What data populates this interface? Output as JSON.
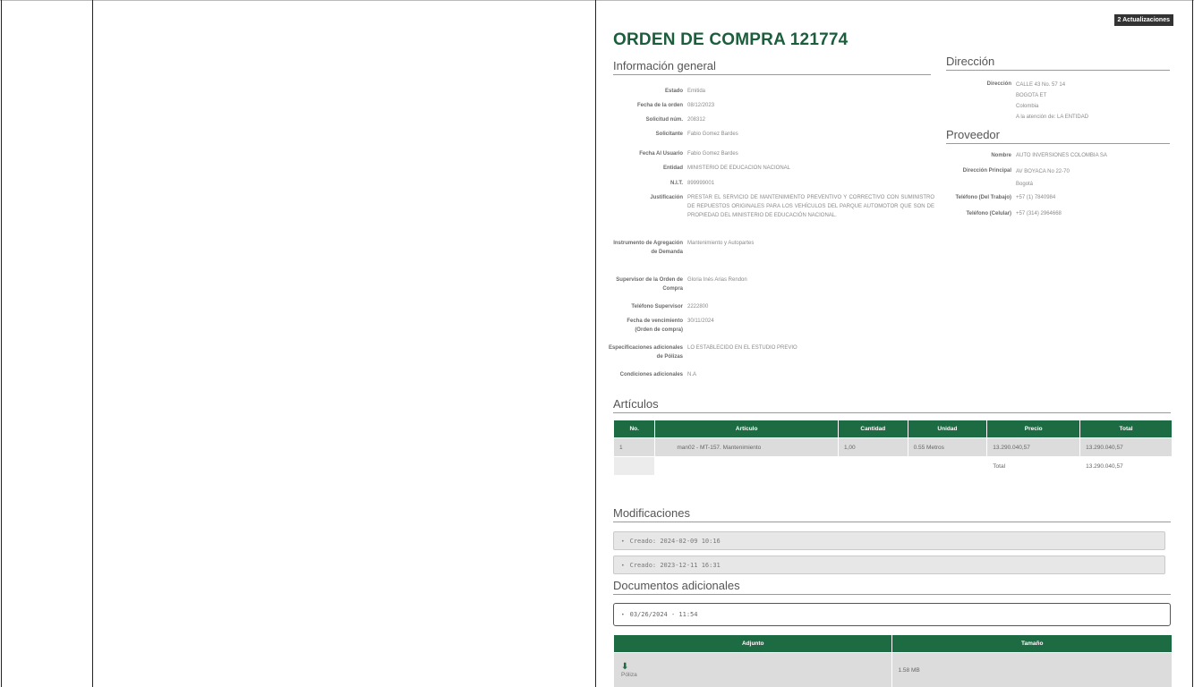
{
  "badge": "2 Actualizaciones",
  "title": "ORDEN DE COMPRA 121774",
  "info": {
    "heading": "Información general",
    "rows": [
      {
        "k": "Estado",
        "v": "Emitida"
      },
      {
        "k": "Fecha de la orden",
        "v": "08/12/2023"
      },
      {
        "k": "Solicitud núm.",
        "v": "208312"
      },
      {
        "k": "Solicitante",
        "v": "Fabio Gomez Bardes"
      },
      {
        "k": "Fecha Al Usuario",
        "v": "Fabio Gomez Bardes"
      },
      {
        "k": "Entidad",
        "v": "MINISTERIO DE EDUCACION NACIONAL"
      },
      {
        "k": "N.I.T.",
        "v": "899999001"
      },
      {
        "k": "Justificación",
        "v": "PRESTAR EL SERVICIO DE MANTENIMIENTO PREVENTIVO Y CORRECTIVO CON SUMINISTRO DE REPUESTOS ORIGINALES PARA LOS VEHÍCULOS DEL PARQUE AUTOMOTOR QUE SON DE PROPIEDAD DEL MINISTERIO DE EDUCACIÓN NACIONAL."
      },
      {
        "k": "Instrumento de Agregación de Demanda",
        "v": "Mantenimiento y Autopartes"
      },
      {
        "k": "Supervisor de la Orden de Compra",
        "v": "Gloria Inés Arias Rendon"
      },
      {
        "k": "Teléfono Supervisor",
        "v": "2222800"
      },
      {
        "k": "Fecha de vencimiento (Orden de compra)",
        "v": "30/11/2024"
      },
      {
        "k": "Especificaciones adicionales de Pólizas",
        "v": "LO ESTABLECIDO EN EL ESTUDIO PREVIO"
      },
      {
        "k": "Condiciones adicionales",
        "v": "N.A"
      }
    ]
  },
  "direccion": {
    "heading": "Dirección",
    "label": "Dirección",
    "lines": [
      "CALLE 43 No. 57 14",
      "BOGOTA ET",
      "Colombia",
      "A la atención de: LA ENTIDAD"
    ]
  },
  "proveedor": {
    "heading": "Proveedor",
    "rows": [
      {
        "k": "Nombre",
        "v": "AUTO INVERSIONES COLOMBIA SA"
      },
      {
        "k": "Dirección Principal",
        "v": "AV BOYACA No 22-70"
      },
      {
        "k": "",
        "v": "Bogotá"
      },
      {
        "k": "Teléfono (Del Trabajo)",
        "v": "+57 (1) 7840984"
      },
      {
        "k": "Teléfono (Celular)",
        "v": "+57 (314) 2964668"
      }
    ]
  },
  "articulos": {
    "heading": "Artículos",
    "headers": [
      "No.",
      "Artículo",
      "Cantidad",
      "Unidad",
      "Precio",
      "Total"
    ],
    "row": [
      "1",
      "man02 - MT-157. Mantenimiento",
      "1,00",
      "0.55 Metros",
      "13.290.040,57",
      "13.290.040,57"
    ],
    "total_label": "Total",
    "total_value": "13.290.040,57"
  },
  "modificaciones": {
    "heading": "Modificaciones",
    "items": [
      "Creado: 2024-02-09 10:16",
      "Creado: 2023-12-11 16:31"
    ]
  },
  "documentos": {
    "heading": "Documentos adicionales",
    "item": "03/26/2024 - 11:54",
    "headers": [
      "Adjunto",
      "Tamaño"
    ],
    "file_name": "Póliza",
    "file_size": "1.58 MB"
  }
}
